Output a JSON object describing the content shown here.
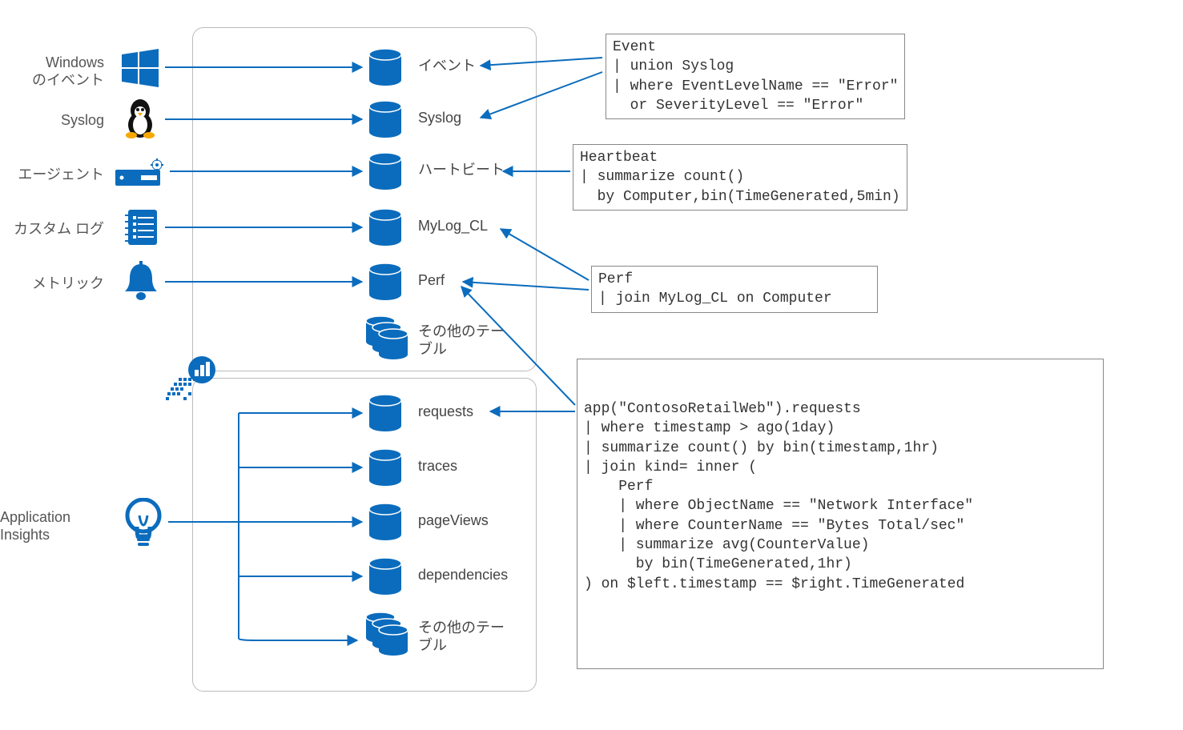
{
  "sources": {
    "windows_events": "Windows\nのイベント",
    "syslog": "Syslog",
    "agent": "エージェント",
    "custom_logs": "カスタム ログ",
    "metrics": "メトリック",
    "app_insights": "Application\nInsights"
  },
  "tables_top": {
    "event": "イベント",
    "syslog": "Syslog",
    "heartbeat": "ハートビート",
    "mylog": "MyLog_CL",
    "perf": "Perf",
    "other": "その他のテー\nブル"
  },
  "tables_bottom": {
    "requests": "requests",
    "traces": "traces",
    "pageviews": "pageViews",
    "dependencies": "dependencies",
    "other": "その他のテー\nブル"
  },
  "queries": {
    "event": "Event\n| union Syslog\n| where EventLevelName == \"Error\"\n  or SeverityLevel == \"Error\"",
    "heartbeat": "Heartbeat\n| summarize count()\n  by Computer,bin(TimeGenerated,5min)",
    "perf": "Perf\n| join MyLog_CL on Computer",
    "app": "app(\"ContosoRetailWeb\").requests\n| where timestamp > ago(1day)\n| summarize count() by bin(timestamp,1hr)\n| join kind= inner (\n    Perf\n    | where ObjectName == \"Network Interface\"\n    | where CounterName == \"Bytes Total/sec\"\n    | summarize avg(CounterValue)\n      by bin(TimeGenerated,1hr)\n) on $left.timestamp == $right.TimeGenerated"
  },
  "colors": {
    "azure_blue": "#0b6cbd",
    "panel_border": "#bbb",
    "query_border": "#888",
    "text": "#333"
  }
}
